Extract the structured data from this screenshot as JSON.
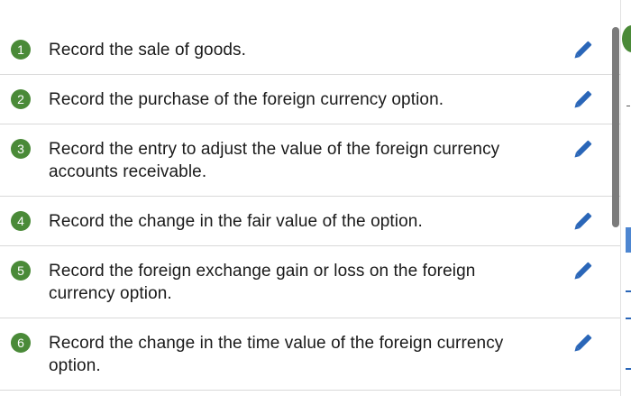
{
  "tasks": [
    {
      "number": "1",
      "label": "Record the sale of goods."
    },
    {
      "number": "2",
      "label": "Record the purchase of the foreign currency option."
    },
    {
      "number": "3",
      "label": "Record the entry to adjust the value of the foreign currency accounts receivable."
    },
    {
      "number": "4",
      "label": "Record the change in the fair value of the option."
    },
    {
      "number": "5",
      "label": "Record the foreign exchange gain or loss on the foreign currency option."
    },
    {
      "number": "6",
      "label": "Record the change in the time value of the foreign currency option."
    }
  ],
  "icons": {
    "edit": "pencil-icon"
  },
  "colors": {
    "badge": "#4a8a38",
    "pencil": "#2a66b8",
    "scrollbar": "#7b7b7b"
  }
}
